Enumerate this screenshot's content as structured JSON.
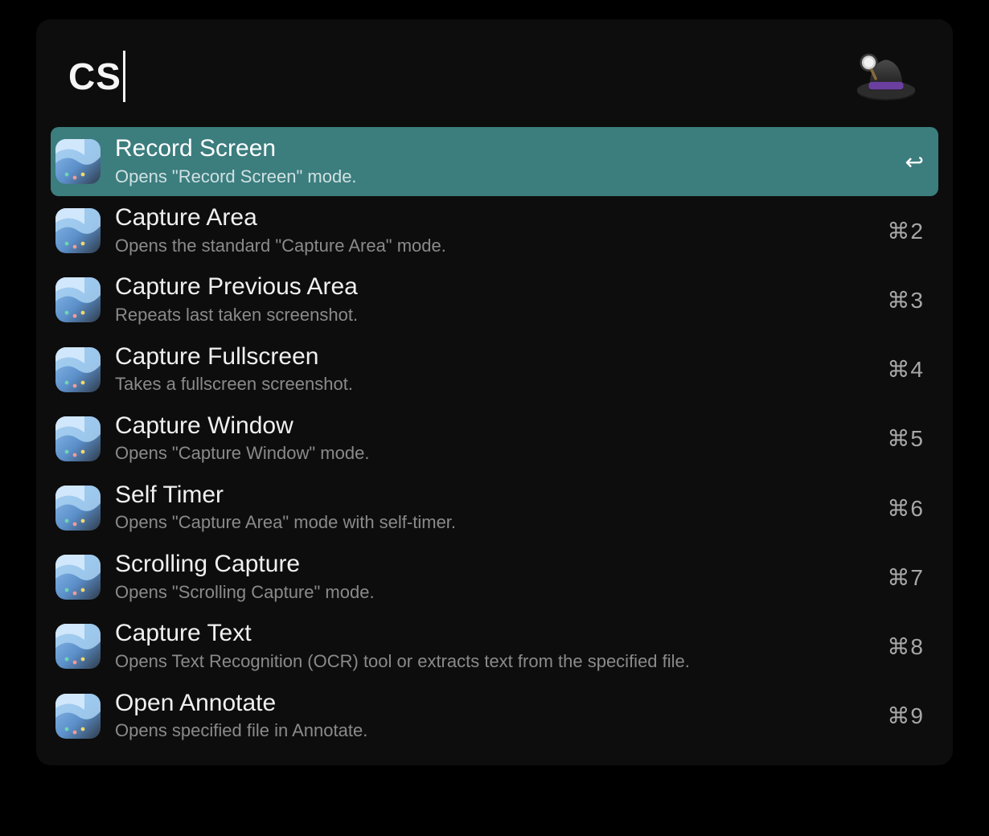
{
  "search": {
    "value": "CS",
    "placeholder": ""
  },
  "colors": {
    "selected_bg": "#3c7d7e",
    "panel_bg": "#0d0d0d"
  },
  "app_icon_name": "alfred-hat-icon",
  "item_icon_name": "cleanshot-app-icon",
  "selected_index": 0,
  "results": [
    {
      "title": "Record Screen",
      "subtitle": "Opens \"Record Screen\" mode.",
      "shortcut": "↩",
      "is_enter": true
    },
    {
      "title": "Capture Area",
      "subtitle": "Opens the standard \"Capture Area\" mode.",
      "shortcut": "⌘2"
    },
    {
      "title": "Capture Previous Area",
      "subtitle": "Repeats last taken screenshot.",
      "shortcut": "⌘3"
    },
    {
      "title": "Capture Fullscreen",
      "subtitle": "Takes a fullscreen screenshot.",
      "shortcut": "⌘4"
    },
    {
      "title": "Capture Window",
      "subtitle": "Opens \"Capture Window\" mode.",
      "shortcut": "⌘5"
    },
    {
      "title": "Self Timer",
      "subtitle": "Opens \"Capture Area\" mode with self-timer.",
      "shortcut": "⌘6"
    },
    {
      "title": "Scrolling Capture",
      "subtitle": "Opens \"Scrolling Capture\" mode.",
      "shortcut": "⌘7"
    },
    {
      "title": "Capture Text",
      "subtitle": "Opens Text Recognition (OCR) tool or extracts text from the specified file.",
      "shortcut": "⌘8"
    },
    {
      "title": "Open Annotate",
      "subtitle": "Opens specified file in Annotate.",
      "shortcut": "⌘9"
    }
  ]
}
